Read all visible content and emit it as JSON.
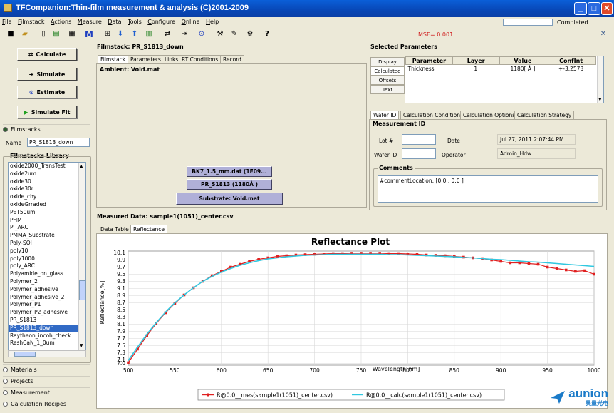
{
  "window": {
    "title": "TFCompanion:Thin-film measurement & analysis (C)2001-2009"
  },
  "menu": [
    "File",
    "Filmstack",
    "Actions",
    "Measure",
    "Data",
    "Tools",
    "Configure",
    "Online",
    "Help"
  ],
  "status": {
    "completed_label": "Completed",
    "progress_fraction": 0,
    "mse": "MSE= 0.001"
  },
  "toolbar_icons": [
    "save-icon",
    "open-folder-icon",
    "new-file-icon",
    "chart-icon",
    "table-icon",
    "m-icon",
    "grid-icon",
    "arrow-down-icon",
    "arrow-up-icon",
    "spreadsheet-icon",
    "calculate-icon",
    "simulate-icon",
    "estimate-icon",
    "wand-icon",
    "tools-icon",
    "config-icon",
    "help-icon"
  ],
  "actions": {
    "calculate": "Calculate",
    "simulate": "Simulate",
    "estimate": "Estimate",
    "simulate_fit": "Simulate Fit"
  },
  "left": {
    "filmstacks_radio": "Filmstacks",
    "name_label": "Name",
    "name_value": "PR_S1813_down",
    "library_title": "Filmstacks Library",
    "library_items": [
      "oxide2000_TransTest",
      "oxide2um",
      "oxide30",
      "oxide30r",
      "oxide_chy",
      "oxideGrraded",
      "PET50um",
      "PHM",
      "PI_ARC",
      "PMMA_Substrate",
      "Poly-SOI",
      "poly10",
      "poly1000",
      "poly_ARC",
      "Polyamide_on_glass",
      "Polymer_2",
      "Polymer_adhesive",
      "Polymer_adhesive_2",
      "Polymer_P1",
      "Polymer_P2_adhesive",
      "PR_S1813",
      "PR_S1813_down",
      "Raytheon_incoh_check",
      "ReshCaN_1_0um"
    ],
    "selected_item": "PR_S1813_down",
    "nav": [
      "Materials",
      "Projects",
      "Measurement",
      "Calculation Recipes"
    ]
  },
  "filmstack": {
    "title": "Filmstack: PR_S1813_down",
    "tabs": [
      "Filmstack",
      "Parameters",
      "Links",
      "RT Conditions",
      "Record"
    ],
    "ambient": "Ambient: Void.mat",
    "layers": [
      "BK7_1.5_mm.dat (1E09...",
      "PR_S1813 (1180Å )"
    ],
    "substrate": "Substrate: Void.mat"
  },
  "selected_params": {
    "title": "Selected Parameters",
    "side_buttons": [
      "Display",
      "Calculated",
      "Offsets",
      "Text"
    ],
    "columns": [
      "Parameter",
      "Layer",
      "Value",
      "ConfInt"
    ],
    "rows": [
      {
        "parameter": "Thickness",
        "layer": "1",
        "value": "1180[ Å ]",
        "confint": "+-3.2573"
      }
    ]
  },
  "wafer": {
    "tabs": [
      "Wafer ID",
      "Calculation Conditions",
      "Calculation Options",
      "Calculation Strategy"
    ],
    "measurement_id_title": "Measurement ID",
    "lot_label": "Lot #",
    "lot_value": "",
    "date_label": "Date",
    "date_value": "Jul 27, 2011 2:07:44 PM",
    "wafer_label": "Wafer ID",
    "wafer_value": "",
    "operator_label": "Operator",
    "operator_value": "Admin_Hdw",
    "comments_title": "Comments",
    "comments_text": "#commentLocation: [0.0 , 0.0 ]"
  },
  "measured": {
    "title": "Measured Data: sample1(1051)_center.csv",
    "tabs": [
      "Data Table",
      "Reflectance"
    ]
  },
  "chart_data": {
    "type": "line",
    "title": "Reflectance Plot",
    "xlabel": "Wavelength[nm]",
    "ylabel": "Reflectance[%]",
    "xlim": [
      500,
      1000
    ],
    "ylim": [
      6.95,
      10.15
    ],
    "xticks": [
      500,
      550,
      600,
      650,
      700,
      750,
      800,
      850,
      900,
      950,
      1000
    ],
    "yticks": [
      7.0,
      7.1,
      7.3,
      7.5,
      7.7,
      7.9,
      8.1,
      8.3,
      8.5,
      8.7,
      8.9,
      9.1,
      9.3,
      9.5,
      9.7,
      9.9,
      10.1
    ],
    "grid": true,
    "legend_position": "bottom",
    "series": [
      {
        "name": "R@0.0__mes(sample1(1051)_center.csv)",
        "color": "#e02020",
        "marker": "square",
        "x": [
          500,
          510,
          520,
          530,
          540,
          550,
          560,
          570,
          580,
          590,
          600,
          610,
          620,
          630,
          640,
          650,
          660,
          670,
          680,
          690,
          700,
          710,
          720,
          730,
          740,
          750,
          760,
          770,
          780,
          790,
          800,
          810,
          820,
          830,
          840,
          850,
          860,
          870,
          880,
          890,
          900,
          910,
          920,
          930,
          940,
          950,
          960,
          970,
          980,
          990,
          1000
        ],
        "y": [
          7.02,
          7.4,
          7.78,
          8.12,
          8.42,
          8.68,
          8.92,
          9.12,
          9.3,
          9.46,
          9.58,
          9.7,
          9.78,
          9.86,
          9.92,
          9.96,
          10.0,
          10.02,
          10.04,
          10.05,
          10.06,
          10.07,
          10.08,
          10.08,
          10.09,
          10.09,
          10.09,
          10.09,
          10.08,
          10.08,
          10.07,
          10.06,
          10.04,
          10.03,
          10.02,
          10.0,
          9.98,
          9.96,
          9.94,
          9.9,
          9.86,
          9.82,
          9.82,
          9.8,
          9.78,
          9.7,
          9.66,
          9.62,
          9.58,
          9.6,
          9.5
        ]
      },
      {
        "name": "R@0.0__calc(sample1(1051)_center.csv)",
        "color": "#30c8e0",
        "marker": "none",
        "x": [
          500,
          510,
          520,
          530,
          540,
          550,
          560,
          570,
          580,
          590,
          600,
          610,
          620,
          630,
          640,
          650,
          660,
          670,
          680,
          690,
          700,
          710,
          720,
          730,
          740,
          750,
          760,
          770,
          780,
          790,
          800,
          810,
          820,
          830,
          840,
          850,
          860,
          870,
          880,
          890,
          900,
          910,
          920,
          930,
          940,
          950,
          960,
          970,
          980,
          990,
          1000
        ],
        "y": [
          7.08,
          7.46,
          7.82,
          8.14,
          8.44,
          8.7,
          8.92,
          9.12,
          9.3,
          9.44,
          9.56,
          9.66,
          9.75,
          9.82,
          9.88,
          9.93,
          9.96,
          9.99,
          10.01,
          10.03,
          10.04,
          10.05,
          10.06,
          10.06,
          10.06,
          10.06,
          10.06,
          10.06,
          10.05,
          10.05,
          10.04,
          10.03,
          10.02,
          10.01,
          10.0,
          9.99,
          9.97,
          9.96,
          9.94,
          9.92,
          9.91,
          9.89,
          9.87,
          9.85,
          9.84,
          9.82,
          9.8,
          9.78,
          9.76,
          9.74,
          9.72
        ]
      }
    ]
  },
  "watermark": {
    "brand": "aunion",
    "sub": "昊量光电"
  }
}
